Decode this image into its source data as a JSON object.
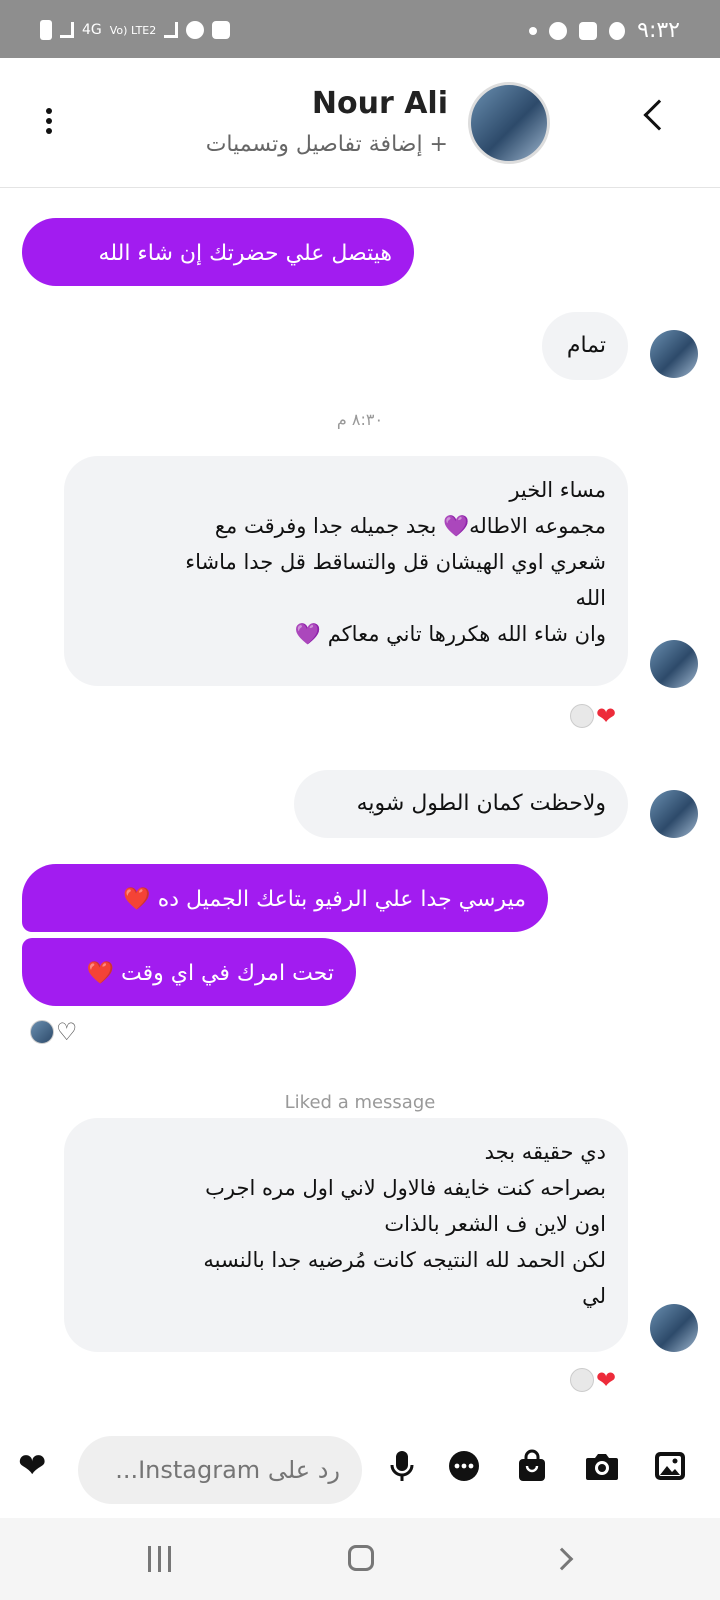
{
  "status_bar": {
    "time": "٩:٣٢",
    "network_1": "4G",
    "network_2": "Vo) LTE2"
  },
  "header": {
    "contact_name": "Nour Ali",
    "subtitle": "+ إضافة تفاصيل وتسميات"
  },
  "messages": {
    "m1": "هيتصل علي حضرتك إن شاء الله",
    "m2": "تمام",
    "timestamp_1": "٨:٣٠ م",
    "m3_l1": "مساء الخير",
    "m3_l2": "مجموعه الاطاله💜 بجد جميله جدا وفرقت مع",
    "m3_l3": "شعري اوي الهيشان قل والتساقط قل جدا ماشاء",
    "m3_l4": "الله",
    "m3_l5": "وان شاء الله هكررها تاني معاكم 💜",
    "m4": "ولاحظت كمان الطول شويه",
    "m5": "ميرسي جدا علي الرفيو بتاعك الجميل ده ❤️",
    "m6": "تحت امرك في اي وقت ❤️",
    "liked_label": "Liked a message",
    "m7_l1": "دي حقيقه بجد",
    "m7_l2": "بصراحه كنت خايفه فالاول لاني اول مره اجرب",
    "m7_l3": "اون لاين ف الشعر بالذات",
    "m7_l4": "لكن الحمد لله النتيجه كانت مُرضيه جدا بالنسبه",
    "m7_l5": "لي"
  },
  "reactions": {
    "heart_symbol": "❤",
    "heart_outline_symbol": "♡"
  },
  "composer": {
    "placeholder": "رد على Instagram..."
  },
  "colors": {
    "outgoing_bubble": "#a21cf0",
    "incoming_bubble": "#f2f3f5",
    "heart_red": "#ed2b3a"
  }
}
